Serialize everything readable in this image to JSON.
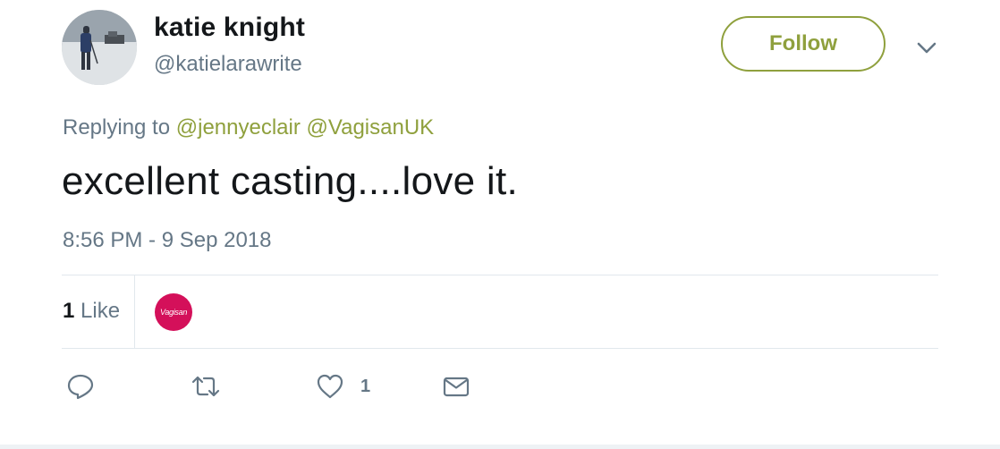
{
  "author": {
    "name": "katie knight",
    "handle": "@katielarawrite",
    "avatar_icon": "profile-photo-snow-scene"
  },
  "follow_button": {
    "label": "Follow",
    "color": "#8fa03d"
  },
  "menu_icon": "chevron-down-icon",
  "reply_context": {
    "prefix": "Replying to",
    "mentions": [
      "@jennyeclair",
      "@VagisanUK"
    ]
  },
  "tweet": {
    "text": "excellent casting....love it.",
    "timestamp": "8:56 PM - 9 Sep 2018"
  },
  "stats": {
    "likes_count": "1",
    "likes_label": "Like",
    "likers": [
      {
        "label": "Vagisan",
        "color": "#d4105a"
      }
    ]
  },
  "actions": {
    "reply_icon": "reply-icon",
    "retweet_icon": "retweet-icon",
    "like_icon": "heart-icon",
    "like_count": "1",
    "dm_icon": "envelope-icon"
  }
}
